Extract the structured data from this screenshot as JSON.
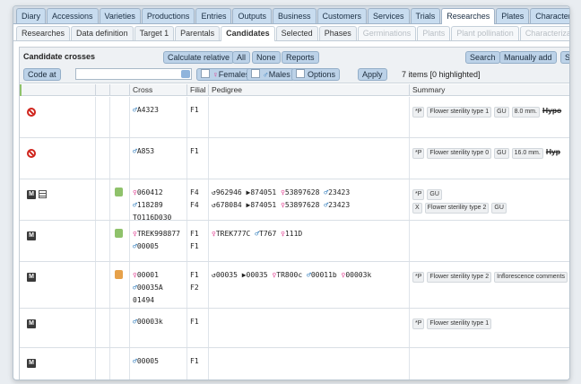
{
  "top_tabs": [
    "Diary",
    "Accessions",
    "Varieties",
    "Productions",
    "Entries",
    "Outputs",
    "Business",
    "Customers",
    "Services",
    "Trials",
    "Researches",
    "Plates",
    "Characteristics"
  ],
  "top_tabs_active": "Researches",
  "sub_tabs": [
    "Researches",
    "Data definition",
    "Target 1",
    "Parentals",
    "Candidates",
    "Selected",
    "Phases",
    "Germinations",
    "Plants",
    "Plant pollination",
    "Characterizati"
  ],
  "sub_tabs_active": "Candidates",
  "sub_tabs_disabled": [
    "Germinations",
    "Plants",
    "Plant pollination",
    "Characterizati"
  ],
  "panel": {
    "title": "Candidate crosses",
    "buttons": {
      "calc": "Calculate relative",
      "all": "All",
      "none": "None",
      "reports": "Reports",
      "search": "Search",
      "manually_add": "Manually add",
      "select": "Sele"
    },
    "code_at": "Code at",
    "code_value": "",
    "females": "Females",
    "males": "Males",
    "options": "Options",
    "apply": "Apply",
    "status": "7 items  [0 highlighted]"
  },
  "columns": {
    "cross": "Cross",
    "filial": "Filial",
    "pedigree": "Pedigree",
    "summary": "Summary"
  },
  "rows": [
    {
      "status": "banned",
      "cross": [
        {
          "sex": "male",
          "code": "A4323"
        }
      ],
      "filial": [
        "F1"
      ],
      "pedigree": [],
      "summary": [
        {
          "tags": [
            "*P",
            "Flower sterility type 1",
            "GU",
            "8.0 mm."
          ],
          "strike": "Hypo"
        }
      ]
    },
    {
      "status": "banned",
      "cross": [
        {
          "sex": "male",
          "code": "A853"
        }
      ],
      "filial": [
        "F1"
      ],
      "pedigree": [],
      "summary": [
        {
          "tags": [
            "*P",
            "Flower sterility type 0",
            "GU",
            "16.0 mm."
          ],
          "strike": "Hyp"
        }
      ]
    },
    {
      "status": "m",
      "cross": [
        {
          "sex": "female",
          "code": "060412"
        },
        {
          "sex": "male",
          "code": "118289"
        },
        {
          "sex": "",
          "code": "TO116D030"
        }
      ],
      "filial": [
        "F4",
        "F4"
      ],
      "pedigree": [
        "↺962946 ▶874051 ♀53897628 ♂23423",
        "↺678084 ▶874051 ♀53897628 ♂23423"
      ],
      "summary": [
        {
          "tags": [
            "*P",
            "GU"
          ],
          "strike": ""
        },
        {
          "tags": [
            "X",
            "Flower sterility type 2",
            "GU"
          ],
          "strike": ""
        }
      ]
    },
    {
      "status": "m",
      "cross": [
        {
          "sex": "female",
          "code": "TREK998877"
        },
        {
          "sex": "male",
          "code": "00005"
        }
      ],
      "filial": [
        "F1",
        "F1"
      ],
      "pedigree": [
        "♀TREK777C ♂T767 ♀111D"
      ],
      "summary": []
    },
    {
      "status": "m",
      "cross": [
        {
          "sex": "female",
          "code": "00001"
        },
        {
          "sex": "male",
          "code": "00035A"
        },
        {
          "sex": "",
          "code": "01494"
        }
      ],
      "filial": [
        "F1",
        "F2"
      ],
      "pedigree": [
        "↺00035 ▶00035 ♀TR800c ♂00011b ♀00003k"
      ],
      "summary": [
        {
          "tags": [
            "*P",
            "Flower sterility type 2",
            "Inflorescence comments"
          ],
          "strike": ""
        }
      ]
    },
    {
      "status": "m",
      "cross": [
        {
          "sex": "male",
          "code": "00003k"
        }
      ],
      "filial": [
        "F1"
      ],
      "pedigree": [],
      "summary": [
        {
          "tags": [
            "*P",
            "Flower sterility type 1"
          ],
          "strike": ""
        }
      ]
    },
    {
      "status": "m",
      "cross": [
        {
          "sex": "male",
          "code": "00005"
        }
      ],
      "filial": [
        "F1"
      ],
      "pedigree": [],
      "summary": []
    }
  ],
  "colors": {
    "accent": "#bcd2e8",
    "female": "#e0398f",
    "male": "#2a78b9",
    "ban": "#d0261e"
  }
}
